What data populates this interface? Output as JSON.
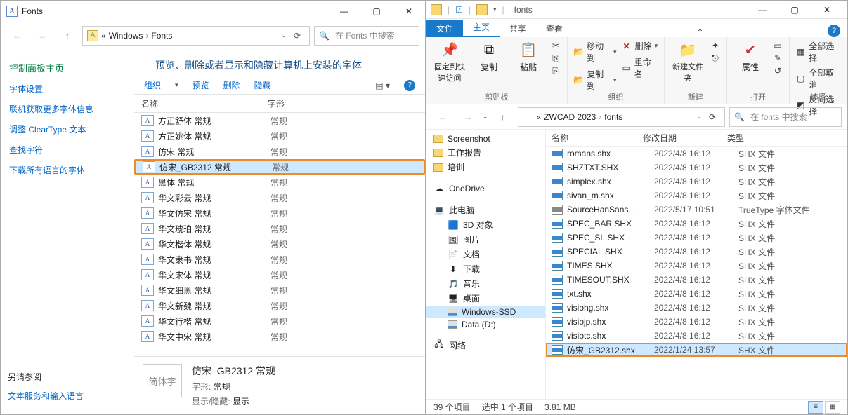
{
  "left": {
    "title": "Fonts",
    "nav": {
      "crumbs": [
        "Windows",
        "Fonts"
      ]
    },
    "search_placeholder": "在 Fonts 中搜索",
    "side": {
      "header": "控制面板主页",
      "links": [
        "字体设置",
        "联机获取更多字体信息",
        "调整 ClearType 文本",
        "查找字符",
        "下载所有语言的字体"
      ],
      "see_also_header": "另请参阅",
      "see_also": [
        "文本服务和输入语言"
      ]
    },
    "main_title": "预览、删除或者显示和隐藏计算机上安装的字体",
    "toolbar": {
      "organize": "组织",
      "preview": "预览",
      "delete": "删除",
      "hide": "隐藏"
    },
    "cols": {
      "name": "名称",
      "shape": "字形"
    },
    "fonts": [
      {
        "name": "方正舒体 常规",
        "shape": "常规"
      },
      {
        "name": "方正姚体 常规",
        "shape": "常规"
      },
      {
        "name": "仿宋 常规",
        "shape": "常规"
      },
      {
        "name": "仿宋_GB2312 常规",
        "shape": "常规",
        "selected": true,
        "highlight": true
      },
      {
        "name": "黑体 常规",
        "shape": "常规"
      },
      {
        "name": "华文彩云 常规",
        "shape": "常规"
      },
      {
        "name": "华文仿宋 常规",
        "shape": "常规"
      },
      {
        "name": "华文琥珀 常规",
        "shape": "常规"
      },
      {
        "name": "华文楷体 常规",
        "shape": "常规"
      },
      {
        "name": "华文隶书 常规",
        "shape": "常规"
      },
      {
        "name": "华文宋体 常规",
        "shape": "常规"
      },
      {
        "name": "华文细黑 常规",
        "shape": "常规"
      },
      {
        "name": "华文新魏 常规",
        "shape": "常规"
      },
      {
        "name": "华文行楷 常规",
        "shape": "常规"
      },
      {
        "name": "华文中宋 常规",
        "shape": "常规"
      }
    ],
    "footer": {
      "sample": "简体字",
      "title": "仿宋_GB2312 常规",
      "shape_label": "字形:",
      "shape_value": "常规",
      "vis_label": "显示/隐藏:",
      "vis_value": "显示"
    }
  },
  "right": {
    "title": "fonts",
    "tabs": {
      "file": "文件",
      "home": "主页",
      "share": "共享",
      "view": "查看"
    },
    "ribbon": {
      "pin": "固定到快速访问",
      "copy": "复制",
      "paste": "粘贴",
      "clipboard": "剪贴板",
      "move_to": "移动到",
      "copy_to": "复制到",
      "delete": "删除",
      "rename": "重命名",
      "organize": "组织",
      "new_folder": "新建文件夹",
      "new": "新建",
      "properties": "属性",
      "open": "打开",
      "select_all": "全部选择",
      "select_none": "全部取消",
      "invert": "反向选择",
      "select": "选择"
    },
    "nav": {
      "crumbs": [
        "ZWCAD 2023",
        "fonts"
      ]
    },
    "search_placeholder": "在 fonts 中搜索",
    "tree": [
      {
        "label": "Screenshot",
        "icon": "folder"
      },
      {
        "label": "工作报告",
        "icon": "folder"
      },
      {
        "label": "培训",
        "icon": "folder"
      },
      {
        "label": "OneDrive",
        "icon": "onedrive",
        "spacer_before": true
      },
      {
        "label": "此电脑",
        "icon": "pc",
        "spacer_before": true
      },
      {
        "label": "3D 对象",
        "icon": "3d",
        "indent": true
      },
      {
        "label": "图片",
        "icon": "pic",
        "indent": true
      },
      {
        "label": "文档",
        "icon": "doc",
        "indent": true
      },
      {
        "label": "下载",
        "icon": "dl",
        "indent": true
      },
      {
        "label": "音乐",
        "icon": "mus",
        "indent": true
      },
      {
        "label": "桌面",
        "icon": "desk",
        "indent": true
      },
      {
        "label": "Windows-SSD",
        "icon": "hdd",
        "indent": true,
        "selected": true
      },
      {
        "label": "Data (D:)",
        "icon": "hdd",
        "indent": true
      },
      {
        "label": "网络",
        "icon": "net",
        "spacer_before": true
      }
    ],
    "cols": {
      "name": "名称",
      "date": "修改日期",
      "type": "类型"
    },
    "files": [
      {
        "name": "romans.shx",
        "date": "2022/4/8 16:12",
        "type": "SHX 文件"
      },
      {
        "name": "SHZTXT.SHX",
        "date": "2022/4/8 16:12",
        "type": "SHX 文件"
      },
      {
        "name": "simplex.shx",
        "date": "2022/4/8 16:12",
        "type": "SHX 文件"
      },
      {
        "name": "sivan_m.shx",
        "date": "2022/4/8 16:12",
        "type": "SHX 文件"
      },
      {
        "name": "SourceHanSans...",
        "date": "2022/5/17 10:51",
        "type": "TrueType 字体文件",
        "ttf": true
      },
      {
        "name": "SPEC_BAR.SHX",
        "date": "2022/4/8 16:12",
        "type": "SHX 文件"
      },
      {
        "name": "SPEC_SL.SHX",
        "date": "2022/4/8 16:12",
        "type": "SHX 文件"
      },
      {
        "name": "SPECIAL.SHX",
        "date": "2022/4/8 16:12",
        "type": "SHX 文件"
      },
      {
        "name": "TIMES.SHX",
        "date": "2022/4/8 16:12",
        "type": "SHX 文件"
      },
      {
        "name": "TIMESOUT.SHX",
        "date": "2022/4/8 16:12",
        "type": "SHX 文件"
      },
      {
        "name": "txt.shx",
        "date": "2022/4/8 16:12",
        "type": "SHX 文件"
      },
      {
        "name": "visiohg.shx",
        "date": "2022/4/8 16:12",
        "type": "SHX 文件"
      },
      {
        "name": "visiojp.shx",
        "date": "2022/4/8 16:12",
        "type": "SHX 文件"
      },
      {
        "name": "visiotc.shx",
        "date": "2022/4/8 16:12",
        "type": "SHX 文件"
      },
      {
        "name": "仿宋_GB2312.shx",
        "date": "2022/1/24 13:57",
        "type": "SHX 文件",
        "selected": true,
        "highlight": true
      }
    ],
    "status": {
      "count": "39 个项目",
      "selected": "选中 1 个项目",
      "size": "3.81 MB"
    }
  }
}
